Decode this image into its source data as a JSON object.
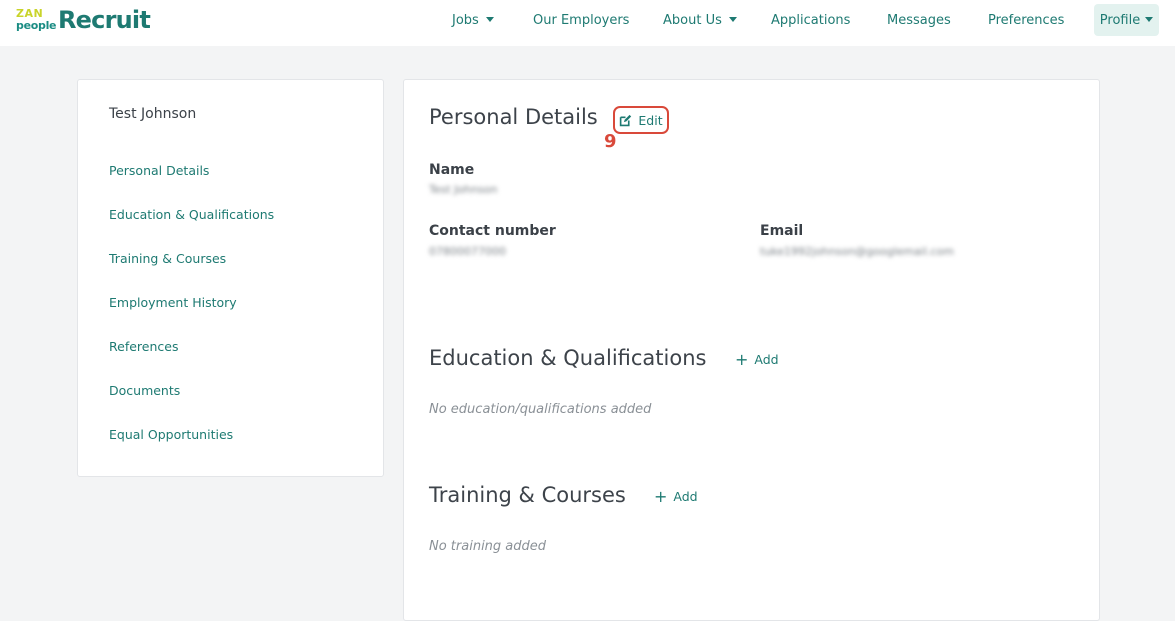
{
  "logo": {
    "mark_top": "ZAN",
    "mark_bottom": "people",
    "word": "Recruit"
  },
  "nav": {
    "jobs": "Jobs",
    "employers": "Our Employers",
    "about": "About Us",
    "applications": "Applications",
    "messages": "Messages",
    "preferences": "Preferences",
    "profile": "Profile"
  },
  "sidebar": {
    "user_name": "Test Johnson",
    "items": [
      {
        "label": "Personal Details"
      },
      {
        "label": "Education & Qualifications"
      },
      {
        "label": "Training & Courses"
      },
      {
        "label": "Employment History"
      },
      {
        "label": "References"
      },
      {
        "label": "Documents"
      },
      {
        "label": "Equal Opportunities"
      }
    ]
  },
  "personal": {
    "title": "Personal Details",
    "edit_label": "Edit",
    "step_number": "9",
    "name_label": "Name",
    "name_value": "Test Johnson",
    "contact_label": "Contact number",
    "contact_value": "07800077000",
    "email_label": "Email",
    "email_value": "tuke1992johnson@googlemail.com"
  },
  "education": {
    "title": "Education & Qualifications",
    "add_label": "Add",
    "empty": "No education/qualifications added"
  },
  "training": {
    "title": "Training & Courses",
    "add_label": "Add",
    "empty": "No training added"
  },
  "colors": {
    "accent": "#1e7a72",
    "highlight": "#d9493a",
    "page_bg": "#f3f4f5"
  }
}
